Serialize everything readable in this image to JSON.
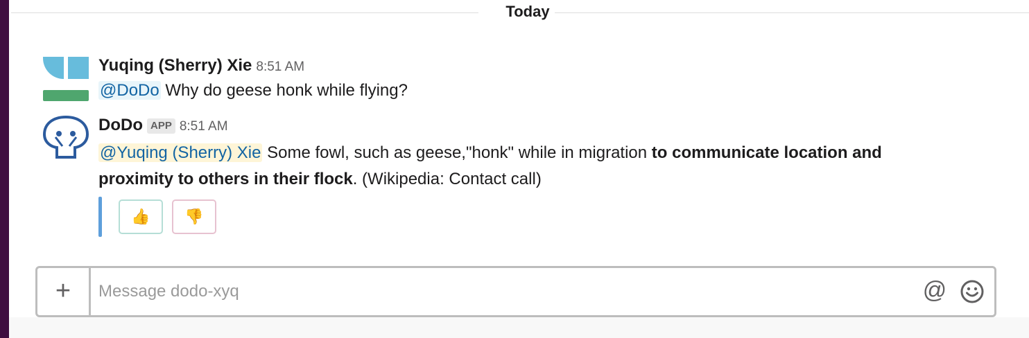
{
  "divider": {
    "label": "Today"
  },
  "messages": [
    {
      "sender": "Yuqing (Sherry) Xie",
      "time": "8:51 AM",
      "mention": "@DoDo",
      "text": "Why do geese honk while flying?"
    },
    {
      "sender": "DoDo",
      "badge": "APP",
      "time": "8:51 AM",
      "mention": "@Yuqing (Sherry) Xie",
      "text_plain_1": "Some fowl, such as geese,\"honk\" while in migration",
      "text_bold_1": "to communicate location and",
      "text_bold_2": "proximity to others in their flock",
      "text_plain_2": ". (Wikipedia: Contact call)"
    }
  ],
  "actions": {
    "thumbs_up": "👍",
    "thumbs_down": "👎"
  },
  "composer": {
    "add_label": "+",
    "placeholder": "Message dodo-xyq",
    "mention_label": "@"
  },
  "colors": {
    "sidebar": "#3f0e40",
    "link": "#1264a3",
    "accent_bar": "#5e9fdb"
  }
}
